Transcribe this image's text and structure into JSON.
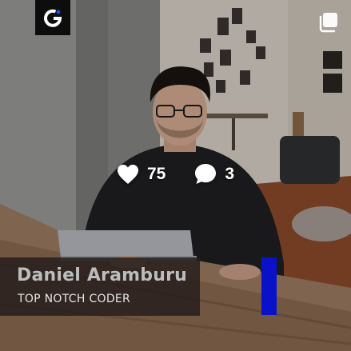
{
  "post": {
    "likes": "75",
    "comments": "3",
    "name": "Daniel Aramburu",
    "role": "TOP NOTCH CODER"
  },
  "icons": {
    "brand": "brand-logo-icon",
    "multi": "multiple-images-icon",
    "like": "heart-icon",
    "comment": "comment-bubble-icon"
  },
  "colors": {
    "accent": "#0a12c9",
    "caption_bg": "#261e1c",
    "name_text": "#bdbdbd",
    "overlay_text": "#ffffff"
  }
}
